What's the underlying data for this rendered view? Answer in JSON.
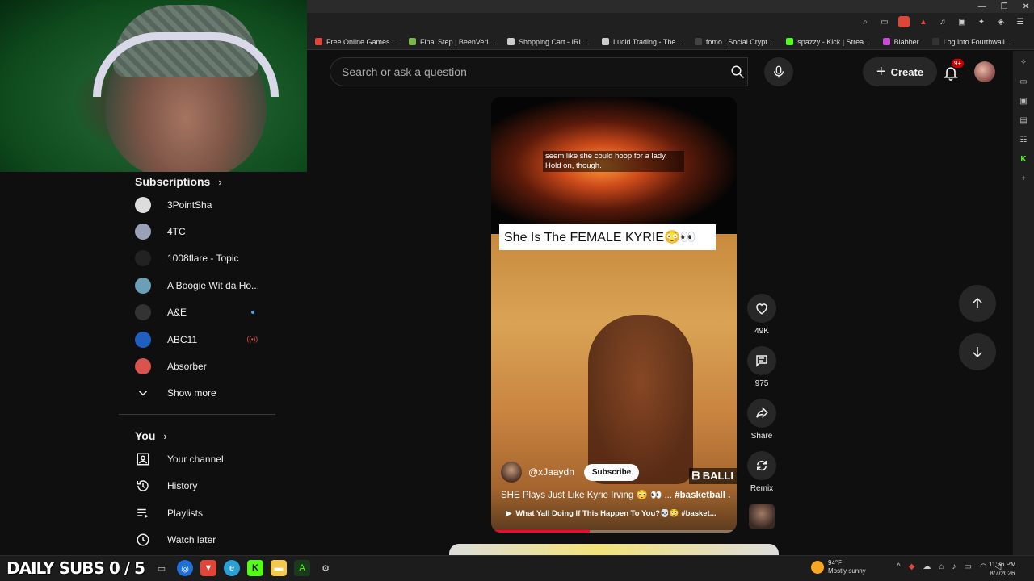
{
  "bookmarks": [
    {
      "label": "Free Online Games...",
      "color": "#e0453a"
    },
    {
      "label": "Final Step | BeenVeri...",
      "color": "#7ab648"
    },
    {
      "label": "Shopping Cart - IRL...",
      "color": "#cccccc"
    },
    {
      "label": "Lucid Trading - The...",
      "color": "#cccccc"
    },
    {
      "label": "fomo | Social Crypt...",
      "color": "#444444"
    },
    {
      "label": "spazzy - Kick | Strea...",
      "color": "#53fc18"
    },
    {
      "label": "Blabber",
      "color": "#c74bd6"
    },
    {
      "label": "Log into Fourthwall...",
      "color": "#333333"
    }
  ],
  "header": {
    "search_placeholder": "Search or ask a question",
    "create_label": "Create",
    "notifications_badge": "9+"
  },
  "sidebar": {
    "subscriptions_label": "Subscriptions",
    "channels": [
      {
        "name": "3PointSha",
        "color": "#dddddd"
      },
      {
        "name": "4TC",
        "color": "#9aa0b8"
      },
      {
        "name": "1008flare - Topic",
        "color": "#222222"
      },
      {
        "name": "A Boogie Wit da Ho...",
        "color": "#6a9fb5"
      },
      {
        "name": "A&E",
        "color": "#333333"
      },
      {
        "name": "ABC11",
        "color": "#1f5fbf"
      },
      {
        "name": "Absorber",
        "color": "#d9534f"
      }
    ],
    "show_more_label": "Show more",
    "you_label": "You",
    "you_items": [
      {
        "label": "Your channel",
        "icon": "person-icon"
      },
      {
        "label": "History",
        "icon": "history-icon"
      },
      {
        "label": "Playlists",
        "icon": "playlists-icon"
      },
      {
        "label": "Watch later",
        "icon": "clock-icon"
      }
    ]
  },
  "short": {
    "caption_line1": "seem like she could hoop for a lady.",
    "caption_line2": "Hold on, though.",
    "banner_title": "She Is The FEMALE KYRIE😳👀",
    "brand_tag": "ᗷ BALLI",
    "channel_handle": "@xJaaydn",
    "subscribe_label": "Subscribe",
    "title_text": "SHE Plays Just Like Kyrie Irving 😳 👀 ... ",
    "title_hashtag": "#basketball ...",
    "related_text": "What Yall Doing If This Happen To You?💀😳 #basket...",
    "progress": 0.4
  },
  "actions": {
    "like_count": "49K",
    "comment_count": "975",
    "share_label": "Share",
    "remix_label": "Remix"
  },
  "taskbar": {
    "subs_goal": "DAILY SUBS 0 / 5",
    "temperature": "94°F",
    "weather_desc": "Mostly sunny",
    "time": "11:36 PM",
    "date": "8/7/2026"
  }
}
